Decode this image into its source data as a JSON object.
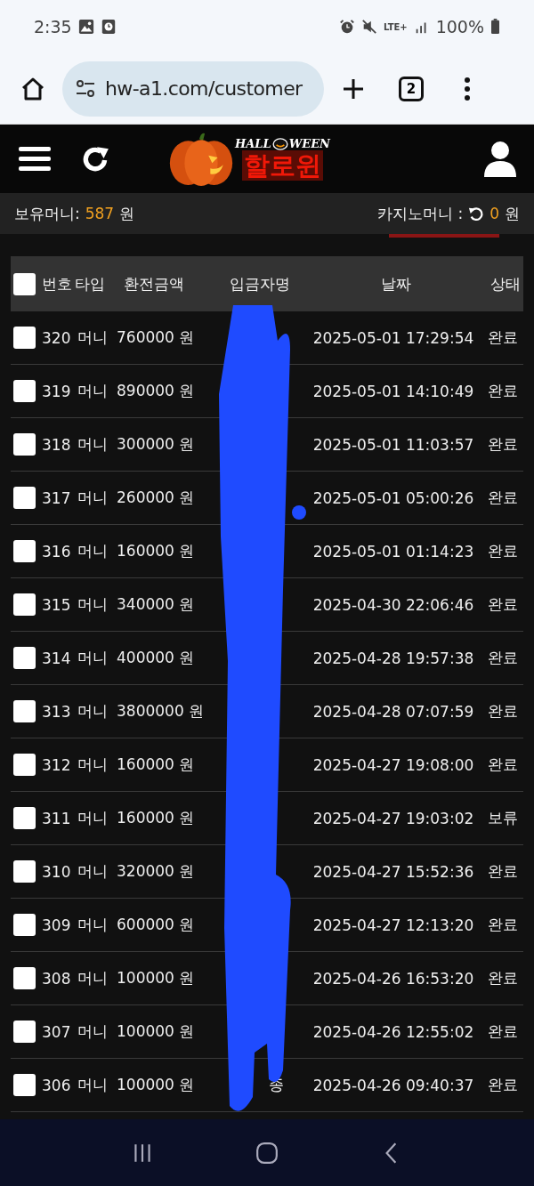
{
  "status_bar": {
    "time": "2:35",
    "network": "LTE+",
    "battery": "100%"
  },
  "browser": {
    "url": "hw-a1.com/customer",
    "tab_count": "2"
  },
  "site_header": {
    "logo_top_left": "HALL",
    "logo_top_right": "WEEN",
    "logo_main": "할로윈"
  },
  "balance_bar": {
    "held_label": "보유머니:",
    "held_amount": "587",
    "held_unit": "원",
    "casino_label": "카지노머니 :",
    "casino_amount": "0",
    "casino_unit": "원"
  },
  "table": {
    "select_all_checked": false,
    "columns": [
      "번호",
      "타입",
      "환전금액",
      "입금자명",
      "날짜",
      "상태"
    ],
    "rows": [
      {
        "checked": false,
        "number": "320",
        "type": "머니",
        "amount": "760000 원",
        "date": "2025-05-01 17:29:54",
        "status": "완료"
      },
      {
        "checked": false,
        "number": "319",
        "type": "머니",
        "amount": "890000 원",
        "date": "2025-05-01 14:10:49",
        "status": "완료"
      },
      {
        "checked": false,
        "number": "318",
        "type": "머니",
        "amount": "300000 원",
        "date": "2025-05-01 11:03:57",
        "status": "완료"
      },
      {
        "checked": false,
        "number": "317",
        "type": "머니",
        "amount": "260000 원",
        "date": "2025-05-01 05:00:26",
        "status": "완료"
      },
      {
        "checked": false,
        "number": "316",
        "type": "머니",
        "amount": "160000 원",
        "date": "2025-05-01 01:14:23",
        "status": "완료"
      },
      {
        "checked": false,
        "number": "315",
        "type": "머니",
        "amount": "340000 원",
        "date": "2025-04-30 22:06:46",
        "status": "완료"
      },
      {
        "checked": false,
        "number": "314",
        "type": "머니",
        "amount": "400000 원",
        "date": "2025-04-28 19:57:38",
        "status": "완료"
      },
      {
        "checked": false,
        "number": "313",
        "type": "머니",
        "amount": "3800000 원",
        "date": "2025-04-28 07:07:59",
        "status": "완료"
      },
      {
        "checked": false,
        "number": "312",
        "type": "머니",
        "amount": "160000 원",
        "date": "2025-04-27 19:08:00",
        "status": "완료"
      },
      {
        "checked": false,
        "number": "311",
        "type": "머니",
        "amount": "160000 원",
        "date": "2025-04-27 19:03:02",
        "status": "보류"
      },
      {
        "checked": false,
        "number": "310",
        "type": "머니",
        "amount": "320000 원",
        "date": "2025-04-27 15:52:36",
        "status": "완료"
      },
      {
        "checked": false,
        "number": "309",
        "type": "머니",
        "amount": "600000 원",
        "date": "2025-04-27 12:13:20",
        "status": "완료"
      },
      {
        "checked": false,
        "number": "308",
        "type": "머니",
        "amount": "100000 원",
        "date": "2025-04-26 16:53:20",
        "status": "완료"
      },
      {
        "checked": false,
        "number": "307",
        "type": "머니",
        "amount": "100000 원",
        "date": "2025-04-26 12:55:02",
        "status": "완료"
      },
      {
        "checked": false,
        "number": "306",
        "type": "머니",
        "amount": "100000 원",
        "name": "종",
        "date": "2025-04-26 09:40:37",
        "status": "완료"
      }
    ]
  }
}
